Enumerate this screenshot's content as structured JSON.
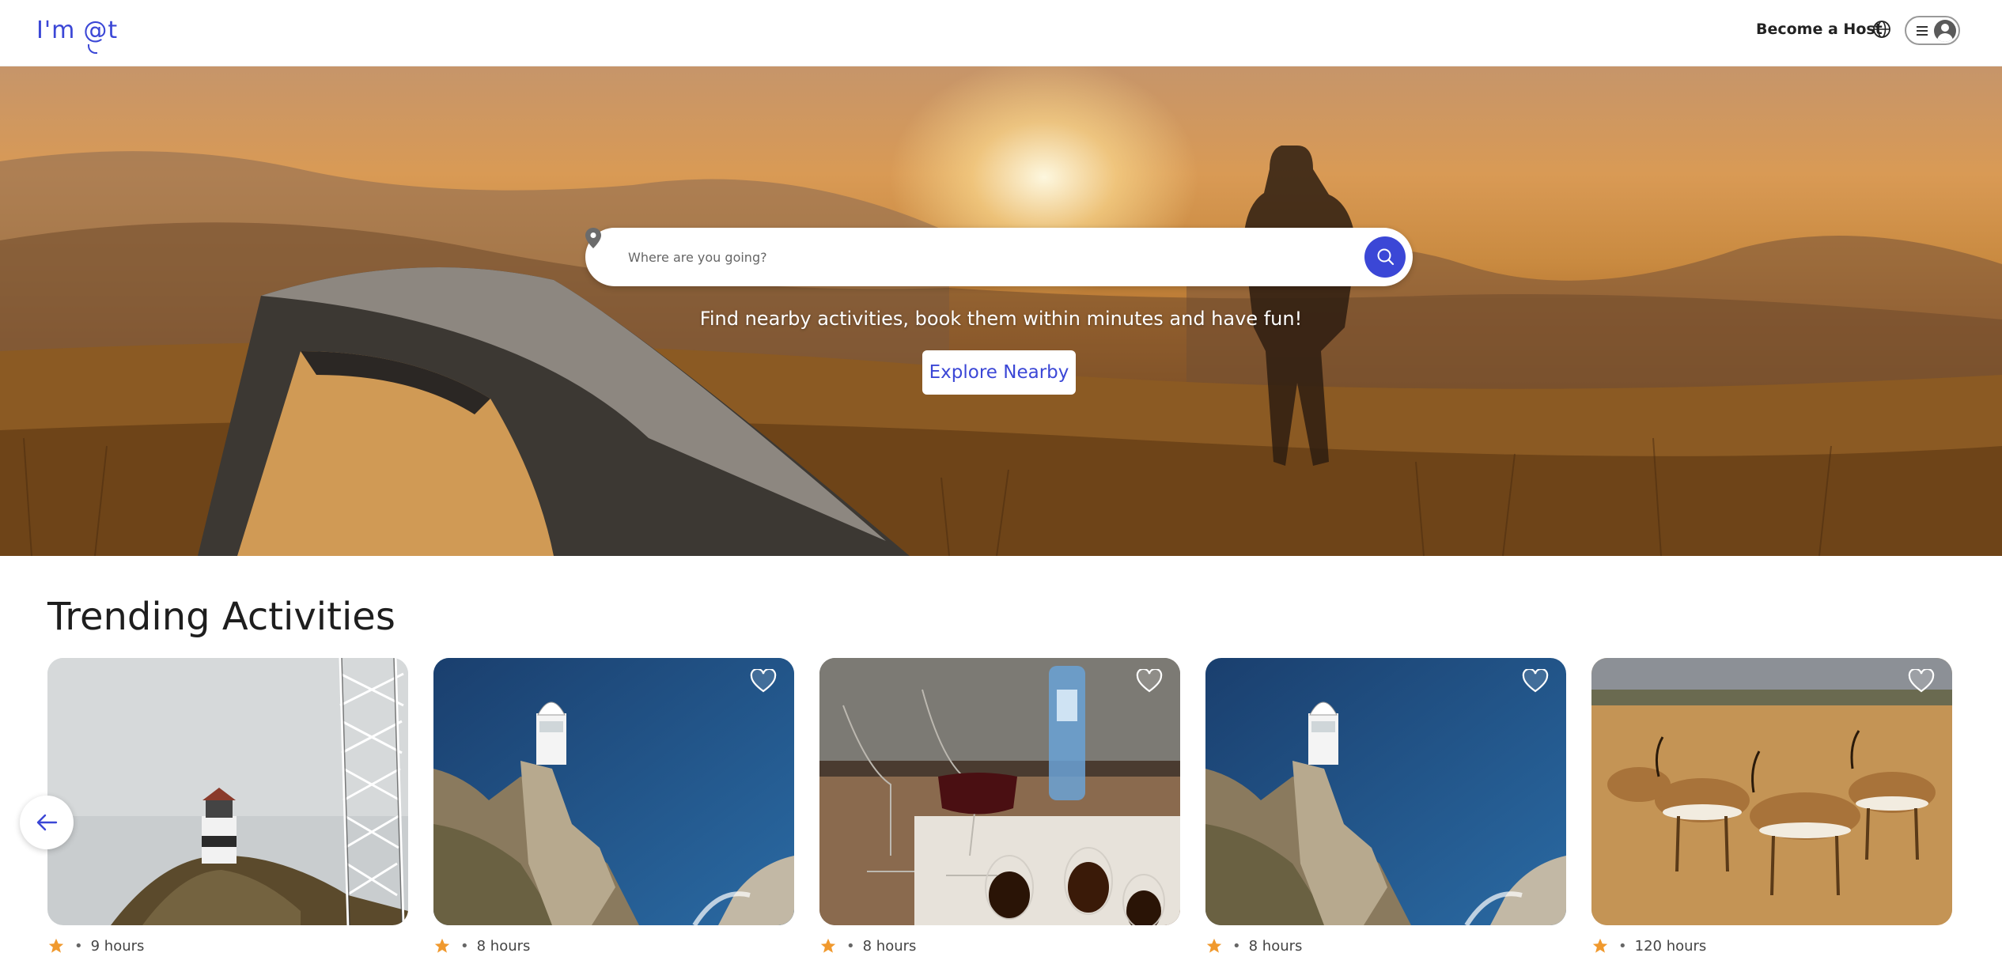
{
  "header": {
    "logo_text": "I'm @t",
    "become_host_label": "Become a Host"
  },
  "hero": {
    "search_placeholder": "Where are you going?",
    "tagline": "Find nearby activities, book them within minutes and have fun!",
    "explore_label": "Explore Nearby"
  },
  "trending": {
    "title": "Trending Activities",
    "cards": [
      {
        "image": "lighthouse-tower-photo",
        "duration": "9 hours",
        "favorite": false
      },
      {
        "image": "lighthouse-cliff-sea-photo",
        "duration": "8 hours",
        "favorite": false
      },
      {
        "image": "wine-tasting-photo",
        "duration": "8 hours",
        "favorite": false
      },
      {
        "image": "lighthouse-cliff-sea-photo",
        "duration": "8 hours",
        "favorite": false
      },
      {
        "image": "springbok-savanna-photo",
        "duration": "120 hours",
        "favorite": false
      }
    ]
  },
  "colors": {
    "accent": "#3b47d6",
    "star": "#f0992e"
  },
  "icons": {
    "globe": "globe-icon",
    "menu": "hamburger-icon",
    "avatar": "user-avatar-icon",
    "pin": "location-pin-icon",
    "search": "search-icon",
    "heart": "heart-icon",
    "star": "star-icon",
    "prev": "arrow-left-icon"
  }
}
